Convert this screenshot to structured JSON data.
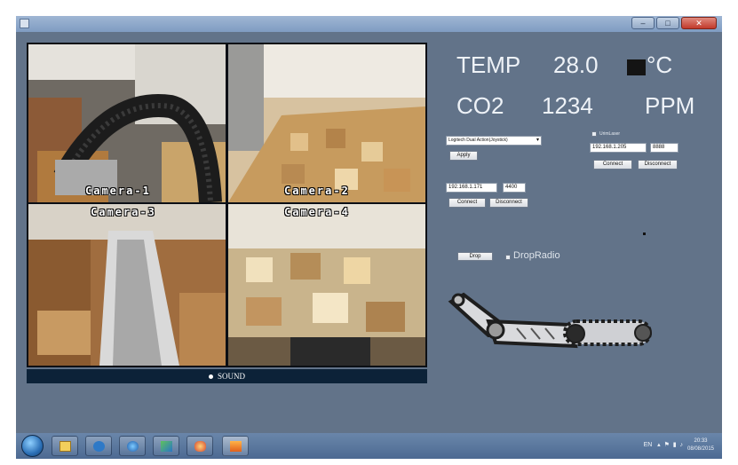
{
  "cameras": [
    {
      "label": "Camera-1"
    },
    {
      "label": "Camera-2"
    },
    {
      "label": "Camera-3"
    },
    {
      "label": "Camera-4"
    }
  ],
  "sound": {
    "label": "SOUND"
  },
  "temp": {
    "label": "TEMP",
    "value": "28.0",
    "unit": "°C"
  },
  "co2": {
    "label": "CO2",
    "value": "1234",
    "unit": "PPM"
  },
  "device": {
    "selected": "Logitech Dual Action(Joystick)",
    "button": "Apply"
  },
  "laser": {
    "checkbox_label": "UrimLaser",
    "ip": "192.168.1.205",
    "port": "8888",
    "connect": "Connect",
    "disconnect": "Disconnect"
  },
  "robot_conn": {
    "ip": "192.168.1.171",
    "port": "4400",
    "connect": "Connect",
    "disconnect": "Disconnect"
  },
  "drop": {
    "button": "Drop",
    "radio_label": "DropRadio"
  },
  "taskbar": {
    "tray": "EN",
    "time": "20:33",
    "date": "08/08/2015"
  },
  "colors": {
    "client_bg": "#627389",
    "taskbar": "#4d6a92",
    "text": "#eef2f7"
  },
  "icons": [
    "windows-start-icon",
    "folder-icon",
    "media-player-icon",
    "browser-icon",
    "paint-icon",
    "game-icon",
    "app-icon"
  ]
}
